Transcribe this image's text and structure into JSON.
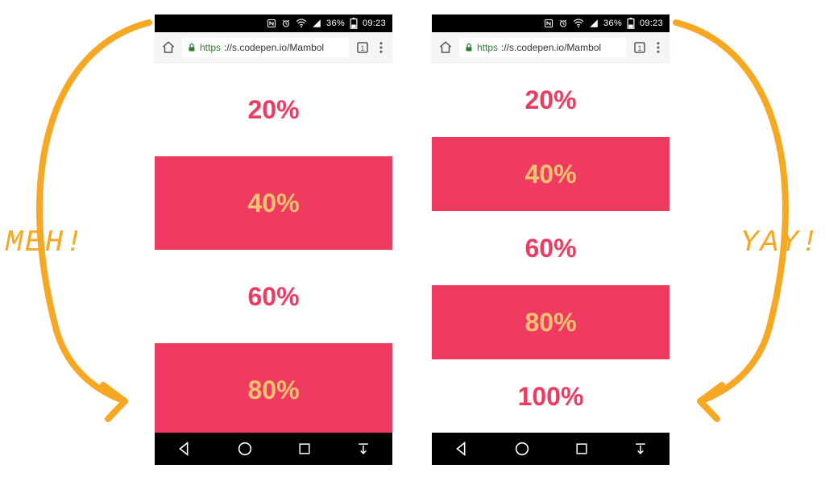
{
  "status": {
    "battery_pct": "36%",
    "time": "09:23"
  },
  "address_bar": {
    "scheme": "https",
    "rest": "://s.codepen.io/Mambol",
    "tab_count": "1"
  },
  "rows": [
    "20%",
    "40%",
    "60%",
    "80%",
    "100%"
  ],
  "labels": {
    "left": "MEH!",
    "right": "YAY!"
  }
}
